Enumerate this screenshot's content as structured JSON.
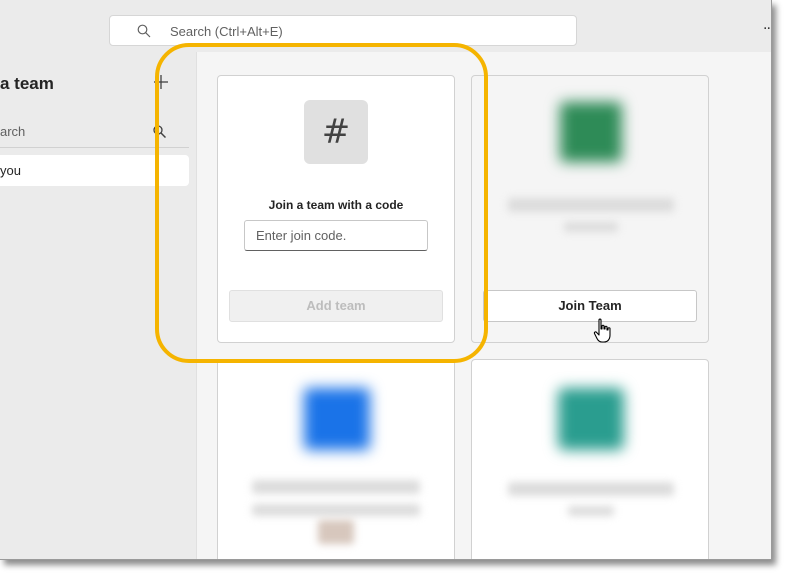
{
  "titlebar": {
    "search_placeholder": "Search (Ctrl+Alt+E)",
    "more_label": ".."
  },
  "sidebar": {
    "title": "a team",
    "search_text": "arch",
    "items": [
      {
        "label": "you"
      }
    ]
  },
  "join_card": {
    "hash_symbol": "#",
    "label": "Join a team with a code",
    "input_placeholder": "Enter join code.",
    "add_button_label": "Add team"
  },
  "team_cards": [
    {
      "accent_color": "#2e8b57",
      "button_label": "Join Team"
    },
    {
      "accent_color": "#1a73e8"
    },
    {
      "accent_color": "#2a9d8f"
    }
  ],
  "colors": {
    "highlight": "#f5b400",
    "background": "#f5f5f5"
  }
}
